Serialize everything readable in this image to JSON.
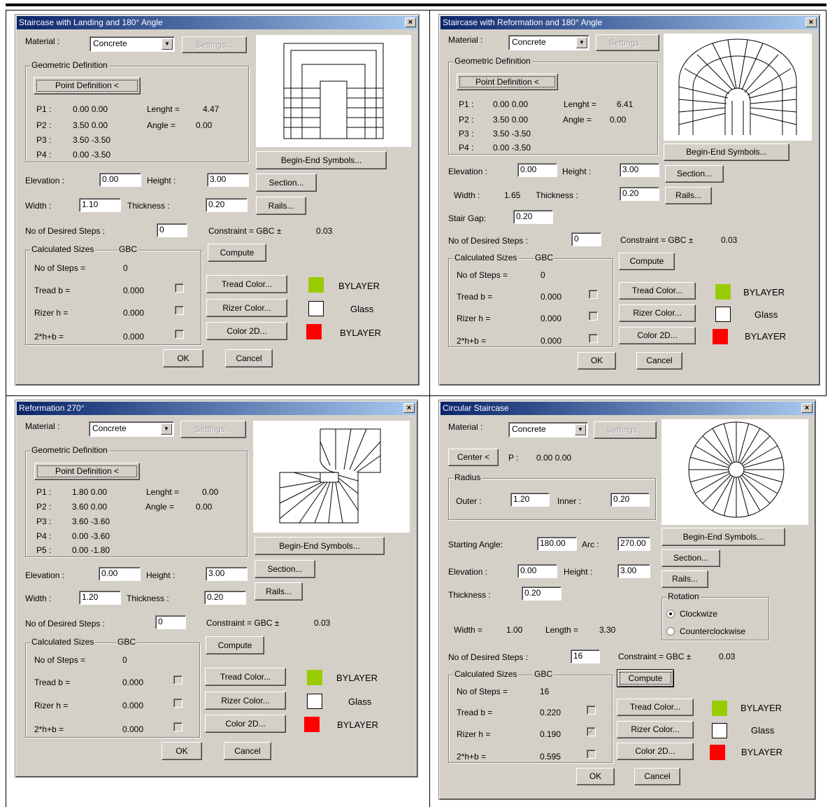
{
  "colors": {
    "green": "#99cc00",
    "white": "#ffffff",
    "red": "#ff0000"
  },
  "d1": {
    "title": "Staircase with Landing and 180° Angle",
    "material_label": "Material :",
    "material_value": "Concrete",
    "settings": "Settings...",
    "geo_group": "Geometric Definition",
    "point_def": "Point Definition <",
    "p1": "P1 :",
    "p1v": "0.00 0.00",
    "p2": "P2 :",
    "p2v": "3.50 0.00",
    "p3": "P3 :",
    "p3v": "3.50 -3.50",
    "p4": "P4 :",
    "p4v": "0.00 -3.50",
    "length_label": "Lenght =",
    "length_value": "4.47",
    "angle_label": "Angle =",
    "angle_value": "0.00",
    "begin_end": "Begin-End Symbols...",
    "elevation_label": "Elevation :",
    "elevation_value": "0.00",
    "height_label": "Height :",
    "height_value": "3.00",
    "section": "Section...",
    "width_label": "Width :",
    "width_value": "1.10",
    "thickness_label": "Thickness :",
    "thickness_value": "0.20",
    "rails": "Rails...",
    "desired_label": "No of Desired Steps :",
    "desired_value": "0",
    "constraint_label": "Constraint = GBC ±",
    "constraint_value": "0.03",
    "calc_group": "Calculated Sizes",
    "gbc": "GBC",
    "compute": "Compute",
    "steps_label": "No of Steps =",
    "steps_value": "0",
    "tread_label": "Tread b =",
    "tread_value": "0.000",
    "rizer_label": "Rizer h =",
    "rizer_value": "0.000",
    "twoh_label": "2*h+b =",
    "twoh_value": "0.000",
    "tread_color": "Tread Color...",
    "rizer_color": "Rizer Color...",
    "color2d": "Color 2D...",
    "tread_layer": "BYLAYER",
    "rizer_layer": "Glass",
    "c2d_layer": "BYLAYER",
    "ok": "OK",
    "cancel": "Cancel"
  },
  "d2": {
    "title": "Staircase with Reformation and 180° Angle",
    "material_label": "Material :",
    "material_value": "Concrete",
    "settings": "Settings...",
    "geo_group": "Geometric Definition",
    "point_def": "Point Definition <",
    "p1": "P1 :",
    "p1v": "0.00 0.00",
    "p2": "P2 :",
    "p2v": "3.50 0.00",
    "p3": "P3 :",
    "p3v": "3.50 -3.50",
    "p4": "P4 :",
    "p4v": "0.00 -3.50",
    "length_label": "Lenght =",
    "length_value": "6.41",
    "angle_label": "Angle =",
    "angle_value": "0.00",
    "begin_end": "Begin-End Symbols...",
    "elevation_label": "Elevation :",
    "elevation_value": "0.00",
    "height_label": "Height :",
    "height_value": "3.00",
    "section": "Section...",
    "width_label": "Width :",
    "width_value": "1.65",
    "thickness_label": "Thickness :",
    "thickness_value": "0.20",
    "rails": "Rails...",
    "gap_label": "Stair Gap:",
    "gap_value": "0.20",
    "desired_label": "No of Desired Steps :",
    "desired_value": "0",
    "constraint_label": "Constraint = GBC ±",
    "constraint_value": "0.03",
    "calc_group": "Calculated Sizes",
    "gbc": "GBC",
    "compute": "Compute",
    "steps_label": "No of Steps =",
    "steps_value": "0",
    "tread_label": "Tread b =",
    "tread_value": "0.000",
    "rizer_label": "Rizer h =",
    "rizer_value": "0.000",
    "twoh_label": "2*h+b =",
    "twoh_value": "0.000",
    "tread_color": "Tread Color...",
    "rizer_color": "Rizer Color...",
    "color2d": "Color 2D...",
    "tread_layer": "BYLAYER",
    "rizer_layer": "Glass",
    "c2d_layer": "BYLAYER",
    "ok": "OK",
    "cancel": "Cancel"
  },
  "d3": {
    "title": "Reformation 270°",
    "material_label": "Material :",
    "material_value": "Concrete",
    "settings": "Settings...",
    "geo_group": "Geometric Definition",
    "point_def": "Point Definition <",
    "p1": "P1 :",
    "p1v": "1.80 0.00",
    "p2": "P2 :",
    "p2v": "3.60 0.00",
    "p3": "P3 :",
    "p3v": "3.60 -3.60",
    "p4": "P4 :",
    "p4v": "0.00 -3.60",
    "p5": "P5 :",
    "p5v": "0.00 -1.80",
    "length_label": "Lenght =",
    "length_value": "0.00",
    "angle_label": "Angle =",
    "angle_value": "0.00",
    "begin_end": "Begin-End Symbols...",
    "elevation_label": "Elevation :",
    "elevation_value": "0.00",
    "height_label": "Height :",
    "height_value": "3.00",
    "section": "Section...",
    "width_label": "Width :",
    "width_value": "1.20",
    "thickness_label": "Thickness :",
    "thickness_value": "0.20",
    "rails": "Rails...",
    "desired_label": "No of Desired Steps :",
    "desired_value": "0",
    "constraint_label": "Constraint = GBC ±",
    "constraint_value": "0.03",
    "calc_group": "Calculated Sizes",
    "gbc": "GBC",
    "compute": "Compute",
    "steps_label": "No of Steps =",
    "steps_value": "0",
    "tread_label": "Tread b =",
    "tread_value": "0.000",
    "rizer_label": "Rizer h =",
    "rizer_value": "0.000",
    "twoh_label": "2*h+b =",
    "twoh_value": "0.000",
    "tread_color": "Tread Color...",
    "rizer_color": "Rizer Color...",
    "color2d": "Color 2D...",
    "tread_layer": "BYLAYER",
    "rizer_layer": "Glass",
    "c2d_layer": "BYLAYER",
    "ok": "OK",
    "cancel": "Cancel"
  },
  "d4": {
    "title": "Circular Staircase",
    "material_label": "Material :",
    "material_value": "Concrete",
    "settings": "Settings...",
    "center": "Center <",
    "p_label": "P :",
    "p_value": "0.00 0.00",
    "radius_group": "Radius",
    "outer_label": "Outer :",
    "outer_value": "1.20",
    "inner_label": "Inner :",
    "inner_value": "0.20",
    "begin_end": "Begin-End Symbols...",
    "start_label": "Starting Angle:",
    "start_value": "180.00",
    "arc_label": "Arc :",
    "arc_value": "270.00",
    "section": "Section...",
    "elevation_label": "Elevation :",
    "elevation_value": "0.00",
    "height_label": "Height :",
    "height_value": "3.00",
    "rails": "Rails...",
    "thickness_label": "Thickness :",
    "thickness_value": "0.20",
    "rotation_group": "Rotation",
    "clockwise": "Clockwize",
    "counter": "Counterclockwise",
    "width_label": "Width =",
    "width_value": "1.00",
    "length_label": "Length =",
    "length_value": "3.30",
    "desired_label": "No of Desired Steps :",
    "desired_value": "16",
    "constraint_label": "Constraint = GBC ±",
    "constraint_value": "0.03",
    "calc_group": "Calculated Sizes",
    "gbc": "GBC",
    "compute": "Compute",
    "steps_label": "No of Steps =",
    "steps_value": "16",
    "tread_label": "Tread b =",
    "tread_value": "0.220",
    "rizer_label": "Rizer h =",
    "rizer_value": "0.190",
    "twoh_label": "2*h+b =",
    "twoh_value": "0.595",
    "tread_color": "Tread Color...",
    "rizer_color": "Rizer Color...",
    "color2d": "Color 2D...",
    "tread_layer": "BYLAYER",
    "rizer_layer": "Glass",
    "c2d_layer": "BYLAYER",
    "ok": "OK",
    "cancel": "Cancel"
  }
}
